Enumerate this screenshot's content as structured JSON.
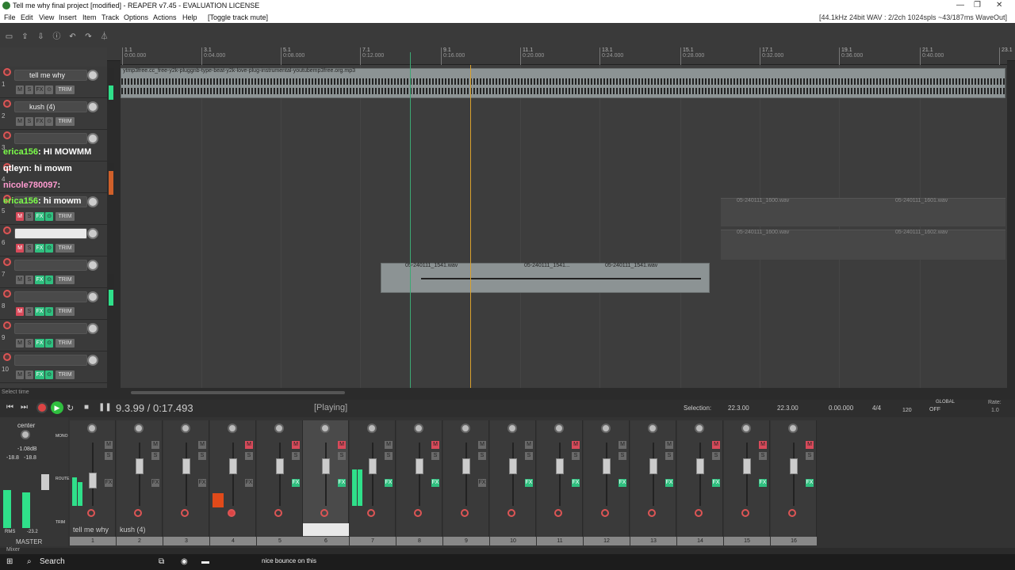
{
  "window": {
    "title": "Tell me why final project [modified] - REAPER v7.45 - EVALUATION LICENSE",
    "minimize": "—",
    "maximize": "❐",
    "close": "✕"
  },
  "menu": {
    "items": [
      "File",
      "Edit",
      "View",
      "Insert",
      "Item",
      "Track",
      "Options",
      "Actions",
      "Help",
      "[Toggle track mute]"
    ],
    "audio_info": "[44.1kHz 24bit WAV : 2/2ch 1024spls ~43/187ms WaveOut]"
  },
  "ruler": {
    "marks": [
      {
        "bar": "1.1",
        "time": "0:00.000"
      },
      {
        "bar": "3.1",
        "time": "0:04.000"
      },
      {
        "bar": "5.1",
        "time": "0:08.000"
      },
      {
        "bar": "7.1",
        "time": "0:12.000"
      },
      {
        "bar": "9.1",
        "time": "0:16.000"
      },
      {
        "bar": "11.1",
        "time": "0:20.000"
      },
      {
        "bar": "13.1",
        "time": "0:24.000"
      },
      {
        "bar": "15.1",
        "time": "0:28.000"
      },
      {
        "bar": "17.1",
        "time": "0:32.000"
      },
      {
        "bar": "19.1",
        "time": "0:36.000"
      },
      {
        "bar": "21.1",
        "time": "0:40.000"
      },
      {
        "bar": "23.1",
        "time": ""
      }
    ]
  },
  "tracks": [
    {
      "num": "1",
      "name": "tell me why"
    },
    {
      "num": "2",
      "name": "kush (4)"
    },
    {
      "num": "3",
      "name": ""
    },
    {
      "num": "4",
      "name": ""
    },
    {
      "num": "5",
      "name": ""
    },
    {
      "num": "6",
      "name": ""
    },
    {
      "num": "7",
      "name": ""
    },
    {
      "num": "8",
      "name": ""
    },
    {
      "num": "9",
      "name": ""
    },
    {
      "num": "10",
      "name": ""
    }
  ],
  "items": {
    "beat": "ytmp3free.cc_free-y2k-pluggnb-type-beat-y2k-love-plug-instrumental-youtubemp3free.org.mp3",
    "vox1": "05-240111_1541.wav",
    "vox2": "05-240111_1541...",
    "vox3": "05-240111_1541.wav",
    "ghost1": "05-240111_1600.wav",
    "ghost2": "05-240111_1601.wav",
    "ghost3": "05-240111_1600.wav",
    "ghost4": "05-240111_1602.wav"
  },
  "chat": [
    {
      "user": "erica156",
      "msg": ": HI MOWMM",
      "color": "#7cff4a"
    },
    {
      "user": "qtleyn",
      "msg": ": hi mowm",
      "color": "#ffffff"
    },
    {
      "user": "nicole780097",
      "msg": ":",
      "color": "#ff9ad0"
    },
    {
      "user": "erica156",
      "msg": ": hi mowm",
      "color": "#7cff4a"
    }
  ],
  "buttons": {
    "m": "M",
    "s": "S",
    "fx": "FX",
    "io": "⊙",
    "trim": "TRIM"
  },
  "status": {
    "hint": "Select time"
  },
  "transport": {
    "position": "9.3.99 / 0:17.493",
    "state": "[Playing]",
    "selection_label": "Selection:",
    "sel_start": "22.3.00",
    "sel_end": "22.3.00",
    "sel_len": "0.00.000",
    "time_sig": "4/4",
    "bpm": "120",
    "global": "GLOBAL",
    "global_state": "OFF",
    "rate_label": "Rate:",
    "rate": "1.0"
  },
  "master": {
    "label": "MASTER",
    "pan": "center",
    "vol": "-1.08dB",
    "peak_l": "-18.8",
    "peak_r": "-18.8",
    "rms": "RMS",
    "rms_val": "-23.2",
    "mono": "MONO",
    "route": "ROUTE",
    "trim": "TRIM"
  },
  "mixer": {
    "channels": [
      "tell me why",
      "kush (4)",
      "",
      "",
      "",
      "",
      "",
      "",
      "",
      "",
      "",
      "",
      "",
      "",
      "",
      ""
    ],
    "numbers": [
      "1",
      "2",
      "3",
      "4",
      "5",
      "6",
      "7",
      "8",
      "9",
      "10",
      "11",
      "12",
      "13",
      "14",
      "15",
      "16"
    ],
    "tab": "Mixer"
  },
  "taskbar": {
    "search": "Search",
    "notification": "nice bounce on this"
  },
  "colors": {
    "accent_green": "#2fbf7f",
    "mute_red": "#d84a5a",
    "play_cursor": "#3da874",
    "edit_cursor": "#d9a12d"
  }
}
